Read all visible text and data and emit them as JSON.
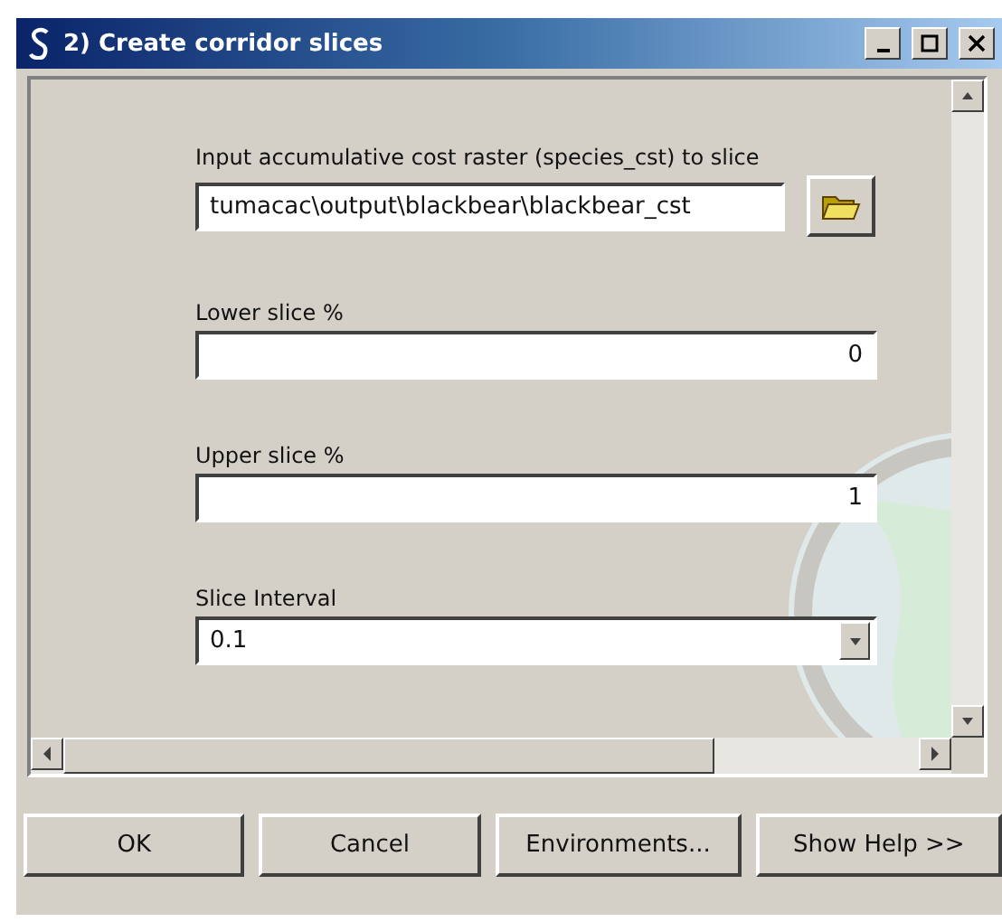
{
  "window": {
    "title": "2) Create corridor slices"
  },
  "fields": [
    {
      "kind": "path",
      "label": "Input accumulative cost raster (species_cst) to slice",
      "value": "tumacac\\output\\blackbear\\blackbear_cst"
    },
    {
      "kind": "number",
      "label": "Lower slice %",
      "value": "0"
    },
    {
      "kind": "number",
      "label": "Upper slice %",
      "value": "1"
    },
    {
      "kind": "dropdown",
      "label": "Slice Interval",
      "value": "0.1"
    }
  ],
  "buttons": [
    "OK",
    "Cancel",
    "Environments...",
    "Show Help >>"
  ]
}
